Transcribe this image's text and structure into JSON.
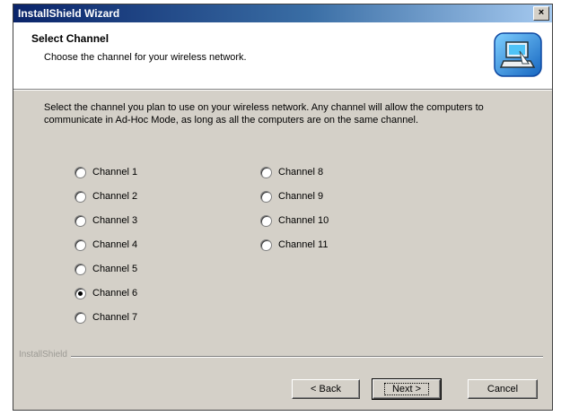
{
  "window": {
    "title": "InstallShield Wizard",
    "close_symbol": "×"
  },
  "header": {
    "title": "Select Channel",
    "subtitle": "Choose the channel for your wireless network.",
    "logo_icon": "installer-computer-icon"
  },
  "instructions": "Select the channel you plan to use on your wireless network. Any channel will allow the computers to communicate in Ad-Hoc Mode, as long as all the computers are on the same channel.",
  "channels": [
    {
      "label": "Channel 1",
      "checked": false
    },
    {
      "label": "Channel 2",
      "checked": false
    },
    {
      "label": "Channel 3",
      "checked": false
    },
    {
      "label": "Channel 4",
      "checked": false
    },
    {
      "label": "Channel 5",
      "checked": false
    },
    {
      "label": "Channel 6",
      "checked": true
    },
    {
      "label": "Channel 7",
      "checked": false
    },
    {
      "label": "Channel 8",
      "checked": false
    },
    {
      "label": "Channel 9",
      "checked": false
    },
    {
      "label": "Channel 10",
      "checked": false
    },
    {
      "label": "Channel 11",
      "checked": false
    }
  ],
  "footer": {
    "brand": "InstallShield"
  },
  "buttons": {
    "back": "< Back",
    "next": "Next >",
    "cancel": "Cancel"
  }
}
